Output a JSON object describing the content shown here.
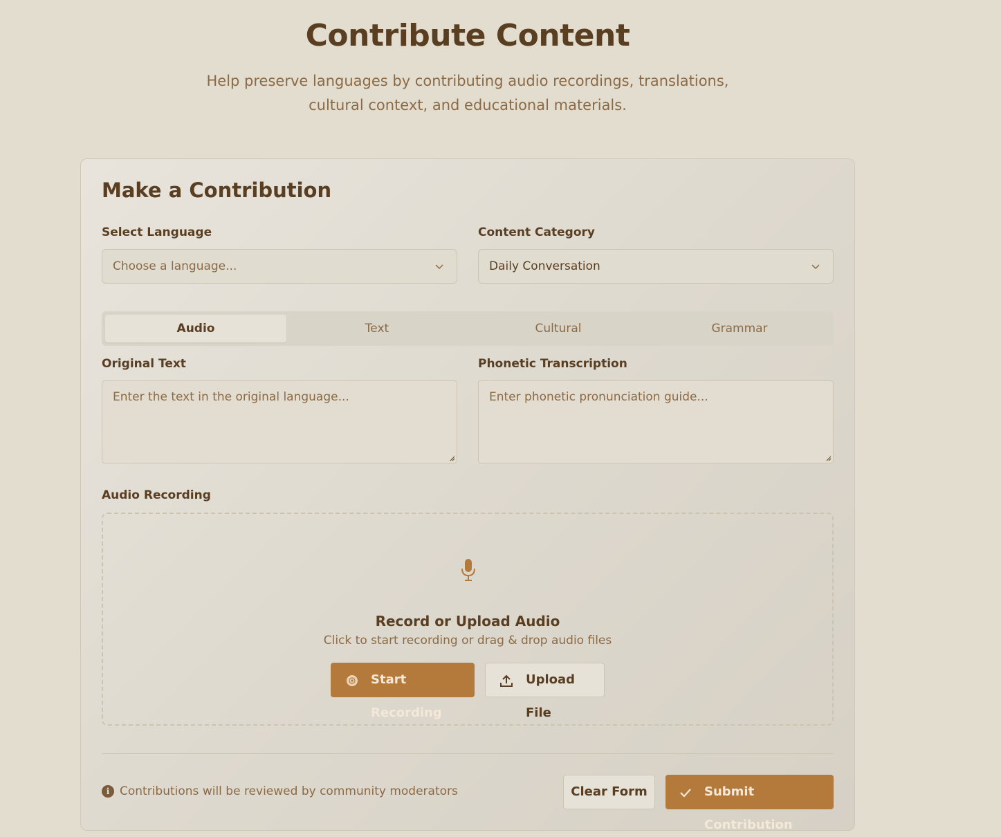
{
  "header": {
    "title": "Contribute Content",
    "subtitle_line1": "Help preserve languages by contributing audio recordings, translations,",
    "subtitle_line2": "cultural context, and educational materials."
  },
  "form": {
    "title": "Make a Contribution",
    "language": {
      "label": "Select Language",
      "value": "Choose a language...",
      "is_placeholder": true
    },
    "category": {
      "label": "Content Category",
      "value": "Daily Conversation"
    },
    "tabs": [
      {
        "label": "Audio",
        "active": true
      },
      {
        "label": "Text",
        "active": false
      },
      {
        "label": "Cultural",
        "active": false
      },
      {
        "label": "Grammar",
        "active": false
      }
    ],
    "original_text": {
      "label": "Original Text",
      "placeholder": "Enter the text in the original language...",
      "value": ""
    },
    "phonetic": {
      "label": "Phonetic Transcription",
      "placeholder": "Enter phonetic pronunciation guide...",
      "value": ""
    },
    "audio": {
      "label": "Audio Recording",
      "icon": "microphone-icon",
      "title": "Record or Upload Audio",
      "subtitle": "Click to start recording or drag & drop audio files",
      "record_label": "Start Recording",
      "upload_label": "Upload File"
    },
    "footer": {
      "notice": "Contributions will be reviewed by community moderators",
      "clear_label": "Clear Form",
      "submit_label": "Submit Contribution"
    }
  },
  "colors": {
    "background": "#e2ddcf",
    "accent": "#b47a3c",
    "text_dark": "#5a3e22",
    "text_muted": "#8c6a45"
  }
}
